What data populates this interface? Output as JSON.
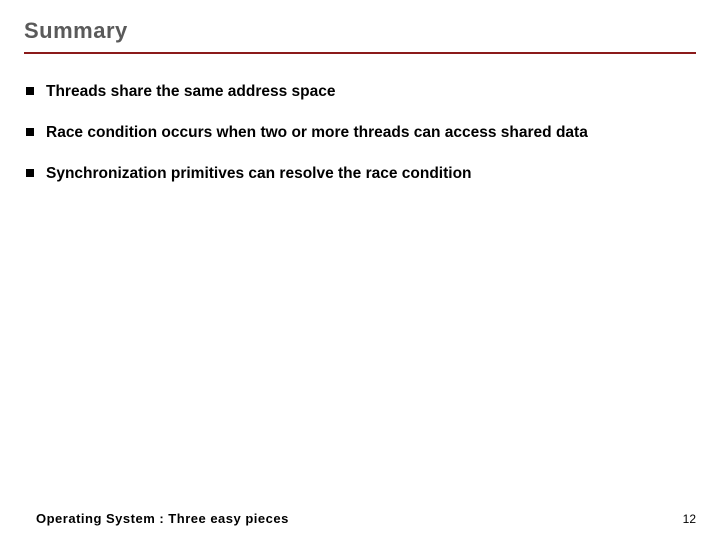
{
  "slide": {
    "title": "Summary",
    "bullets": [
      "Threads share the same address space",
      "Race condition occurs when two or more threads can access shared data",
      "Synchronization primitives can resolve the race condition"
    ],
    "footer_text": "Operating System : Three easy pieces",
    "page_number": "12"
  }
}
